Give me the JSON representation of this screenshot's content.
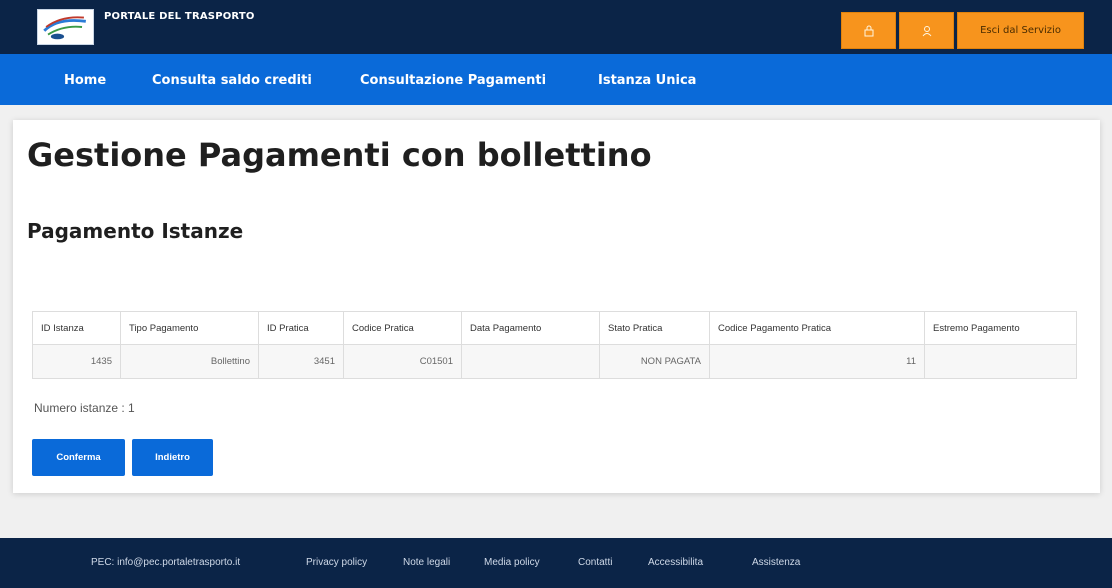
{
  "header": {
    "brand": "PORTALE DEL TRASPORTO",
    "logout_label": "Esci dal Servizio",
    "accent_color": "#f7941d",
    "background_color": "#0b2447"
  },
  "nav": {
    "items": [
      "Home",
      "Consulta saldo crediti",
      "Consultazione Pagamenti",
      "Istanza Unica"
    ],
    "background_color": "#0a6ad9"
  },
  "main": {
    "title": "Gestione Pagamenti con bollettino",
    "section_title": "Pagamento Istanze",
    "table": {
      "columns": [
        "ID Istanza",
        "Tipo Pagamento",
        "ID Pratica",
        "Codice Pratica",
        "Data Pagamento",
        "Stato Pratica",
        "Codice Pagamento Pratica",
        "Estremo Pagamento"
      ],
      "rows": [
        [
          "1435",
          "Bollettino",
          "3451",
          "C01501",
          "",
          "NON PAGATA",
          "11",
          ""
        ]
      ]
    },
    "count_label": "Numero istanze : 1",
    "confirm_label": "Conferma",
    "back_label": "Indietro"
  },
  "footer": {
    "items": [
      "PEC: info@pec.portaletrasporto.it",
      "Privacy policy",
      "Note legali",
      "Media policy",
      "Contatti",
      "Accessibilita",
      "Assistenza"
    ]
  }
}
